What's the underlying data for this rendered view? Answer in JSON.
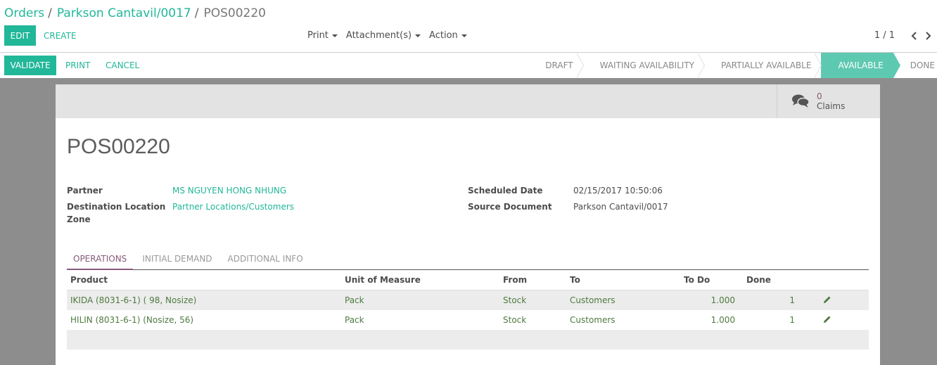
{
  "breadcrumb": {
    "items": [
      "Orders",
      "Parkson Cantavil/0017"
    ],
    "current": "POS00220",
    "separator": "/"
  },
  "control_panel": {
    "edit_label": "EDIT",
    "create_label": "CREATE",
    "menus": [
      "Print",
      "Attachment(s)",
      "Action"
    ],
    "pager_value": "1 / 1"
  },
  "header": {
    "validate_label": "VALIDATE",
    "print_label": "PRINT",
    "cancel_label": "CANCEL",
    "statuses": [
      "DRAFT",
      "WAITING AVAILABILITY",
      "PARTIALLY AVAILABLE",
      "AVAILABLE",
      "DONE"
    ],
    "active_status": "AVAILABLE"
  },
  "button_box": {
    "claims_count": "0",
    "claims_label": "Claims"
  },
  "record": {
    "name": "POS00220",
    "partner_label": "Partner",
    "partner_value": "MS NGUYEN HONG NHUNG",
    "dest_label_line1": "Destination Location",
    "dest_label_line2": "Zone",
    "dest_value": "Partner Locations/Customers",
    "scheduled_label": "Scheduled Date",
    "scheduled_value": "02/15/2017 10:50:06",
    "source_label": "Source Document",
    "source_value": "Parkson Cantavil/0017"
  },
  "tabs": [
    "OPERATIONS",
    "INITIAL DEMAND",
    "ADDITIONAL INFO"
  ],
  "active_tab": "OPERATIONS",
  "table": {
    "headers": [
      "Product",
      "Unit of Measure",
      "From",
      "To",
      "To Do",
      "Done"
    ],
    "rows": [
      {
        "product": "IKIDA (8031-6-1) ( 98, Nosize)",
        "uom": "Pack",
        "from": "Stock",
        "to": "Customers",
        "todo": "1.000",
        "done": "1"
      },
      {
        "product": "HILIN (8031-6-1) (Nosize, 56)",
        "uom": "Pack",
        "from": "Stock",
        "to": "Customers",
        "todo": "1.000",
        "done": "1"
      }
    ]
  },
  "colors": {
    "primary": "#21b799",
    "odoo_purple": "#875a7b",
    "status_active": "#5ec9b1"
  }
}
